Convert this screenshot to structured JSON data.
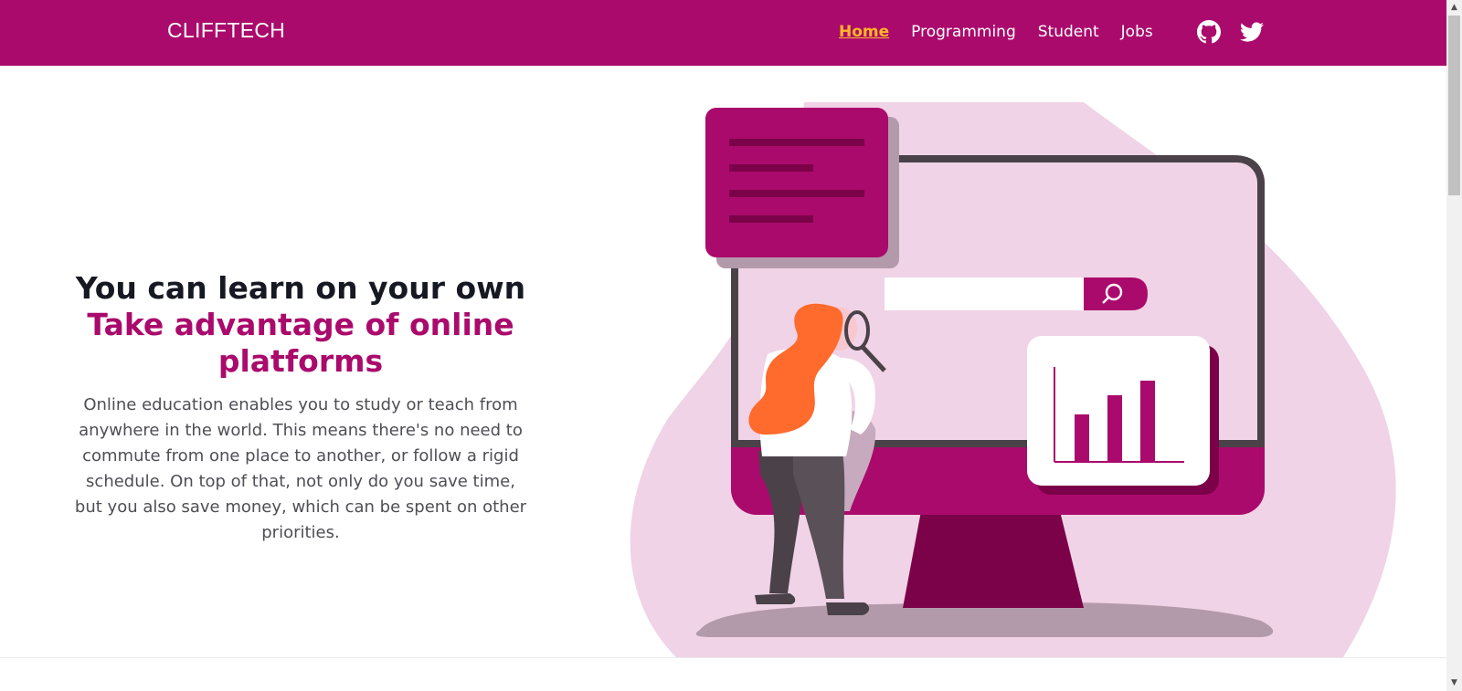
{
  "navbar": {
    "brand": "CLIFFTECH",
    "links": [
      {
        "label": "Home",
        "active": true
      },
      {
        "label": "Programming",
        "active": false
      },
      {
        "label": "Student",
        "active": false
      },
      {
        "label": "Jobs",
        "active": false
      }
    ],
    "social": [
      "github-icon",
      "twitter-icon"
    ]
  },
  "hero": {
    "title": "You can learn on your own",
    "subtitle": "Take advantage of online platforms",
    "description": "Online education enables you to study or teach from anywhere in the world. This means there's no need to commute from one place to another, or follow a rigid schedule. On top of that, not only do you save time, but you also save money, which can be spent on other priorities."
  },
  "illustration": {
    "icons": [
      "monitor-illustration",
      "search-icon",
      "bar-chart-icon",
      "magnifying-glass-icon",
      "woman-figure"
    ]
  },
  "colors": {
    "brand": "#aa0a6c",
    "active_link": "#ffb627",
    "title": "#161922",
    "text": "#4e4e55",
    "blob": "#f0d3e6"
  }
}
